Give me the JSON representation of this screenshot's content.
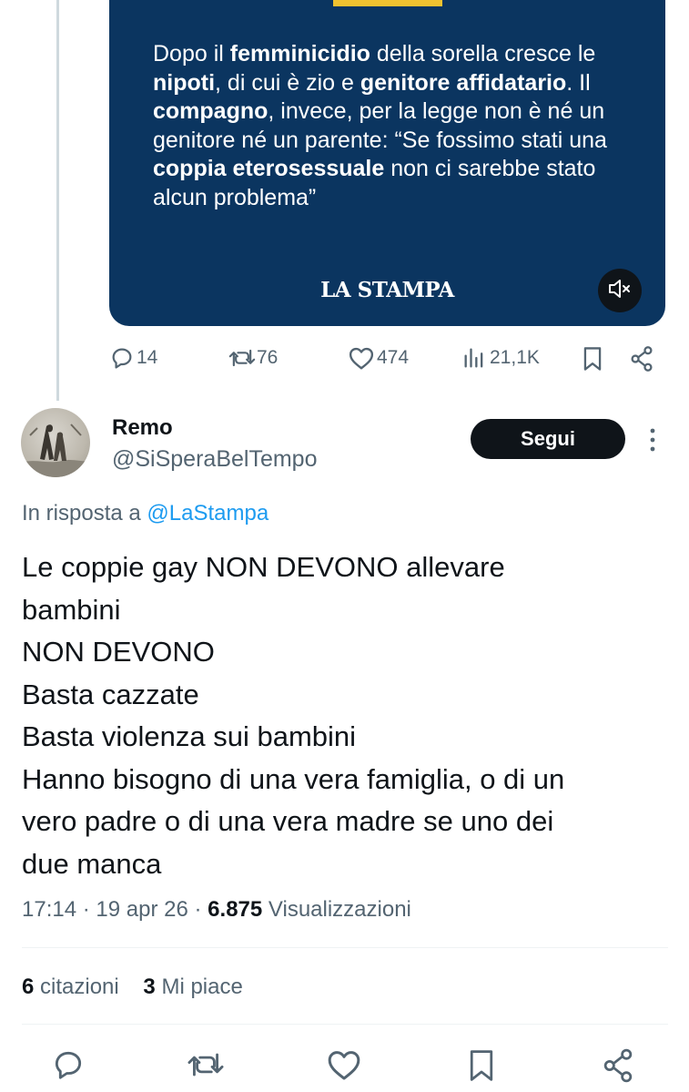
{
  "embed": {
    "quote_parts": [
      {
        "t": "Dopo il ",
        "b": false
      },
      {
        "t": "femminicidio",
        "b": true
      },
      {
        "t": " della sorella cresce le ",
        "b": false
      },
      {
        "t": "nipoti",
        "b": true
      },
      {
        "t": ", di cui è zio e ",
        "b": false
      },
      {
        "t": "genitore affidatario",
        "b": true
      },
      {
        "t": ". Il ",
        "b": false
      },
      {
        "t": "compagno",
        "b": true
      },
      {
        "t": ", invece, per la legge non è né un genitore né un parente: “Se fossimo stati una ",
        "b": false
      },
      {
        "t": "coppia eterosessuale",
        "b": true
      },
      {
        "t": " non ci sarebbe stato alcun problema”",
        "b": false
      }
    ],
    "logo_text": "LA STAMPA",
    "accent_bar_color": "#f2c230",
    "background_color": "#0b3560"
  },
  "parent_actions": {
    "replies": "14",
    "reposts": "76",
    "likes": "474",
    "views": "21,1K"
  },
  "reply": {
    "author_name": "Remo",
    "author_handle": "@SiSperaBelTempo",
    "follow_label": "Segui",
    "reply_to_prefix": "In risposta a",
    "reply_to_handle": "@LaStampa",
    "body_lines": [
      "Le coppie gay NON DEVONO allevare",
      "bambini",
      "NON DEVONO",
      "Basta cazzate",
      "Basta violenza sui bambini",
      "Hanno bisogno di una vera famiglia, o di un",
      "vero padre o di una vera madre se uno dei",
      "due manca"
    ],
    "time": "17:14",
    "date": "19 apr 26",
    "views_count": "6.875",
    "views_label": "Visualizzazioni",
    "quotes_count": "6",
    "quotes_label": "citazioni",
    "likes_count": "3",
    "likes_label": "Mi piace"
  },
  "colors": {
    "secondary_text": "#536471",
    "link": "#1d9bf0",
    "primary_text": "#0f1419"
  }
}
